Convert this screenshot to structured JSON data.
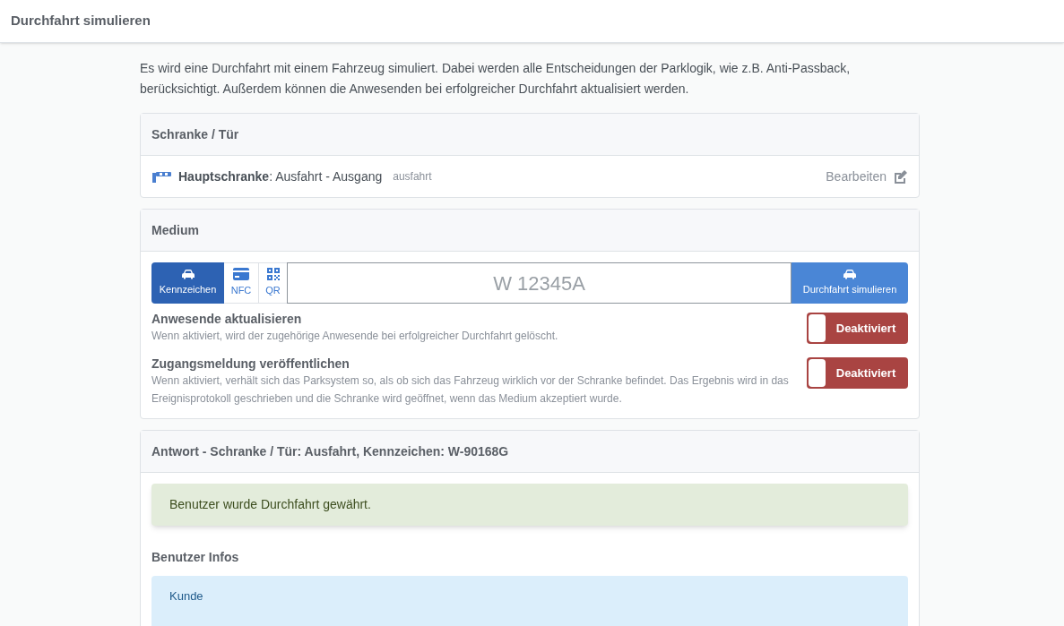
{
  "header": {
    "title": "Durchfahrt simulieren"
  },
  "intro": "Es wird eine Durchfahrt mit einem Fahrzeug simuliert. Dabei werden alle Entscheidungen der Parklogik, wie z.B. Anti-Passback, berücksichtigt. Außerdem können die Anwesenden bei erfolgreicher Durchfahrt aktualisiert werden.",
  "barrier_card": {
    "title": "Schranke / Tür",
    "name": "**Hauptschranke**: Ausfahrt - Ausgang",
    "tag": "ausfahrt",
    "edit": "Bearbeiten"
  },
  "medium_card": {
    "title": "Medium",
    "media_types": [
      {
        "kind": "car",
        "label": "Kennzeichen",
        "selected": true
      },
      {
        "kind": "card",
        "label": "NFC",
        "selected": false
      },
      {
        "kind": "qr",
        "label": "QR",
        "selected": false
      }
    ],
    "plate_field": {
      "placeholder": "W 12345A"
    },
    "simulate_button": "Durchfahrt simulieren",
    "options": [
      {
        "title": "Anwesende aktualisieren",
        "description": "Wenn aktiviert, wird der zugehörige Anwesende bei erfolgreicher Durchfahrt gelöscht.",
        "toggle_label": "Deaktiviert",
        "on": false
      },
      {
        "title": "Zugangsmeldung veröffentlichen",
        "description": "Wenn aktiviert, verhält sich das Parksystem so, als ob sich das Fahrzeug wirklich vor der Schranke befindet. Das Ergebnis wird in das Ereignisprotokoll geschrieben und die Schranke wird geöffnet, wenn das Medium akzeptiert wurde.",
        "toggle_label": "Deaktiviert",
        "on": false
      }
    ]
  },
  "response_card": {
    "title": "Antwort - Schranke / Tür: Ausfahrt, Kennzeichen: W-90168G",
    "alert": "Benutzer wurde Durchfahrt gewährt.",
    "section_title": "Benutzer Infos",
    "info": "Kunde"
  }
}
